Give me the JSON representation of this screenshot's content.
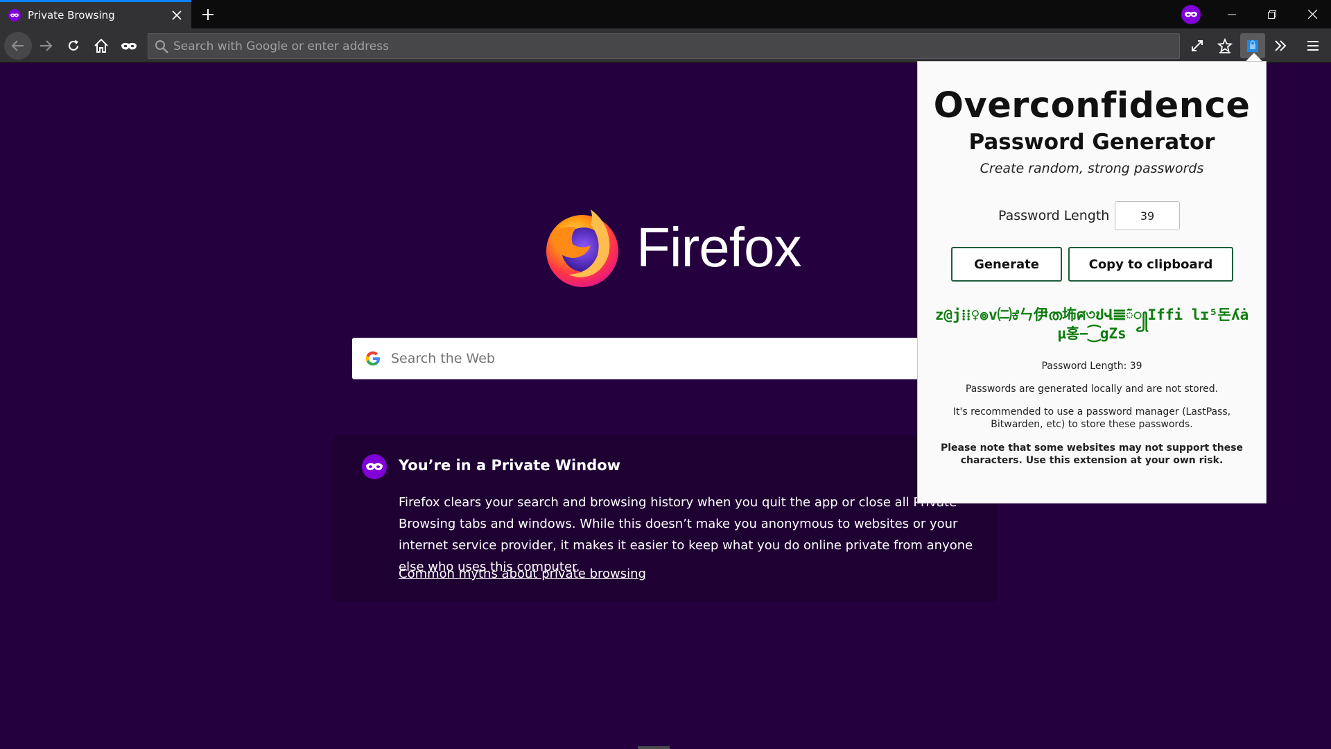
{
  "browser": {
    "tab": {
      "title": "Private Browsing"
    },
    "urlbar": {
      "placeholder": "Search with Google or enter address"
    }
  },
  "page": {
    "logo_text": "Firefox",
    "search_placeholder": "Search the Web",
    "info": {
      "title": "You’re in a Private Window",
      "body": "Firefox clears your search and browsing history when you quit the app or close all Private Browsing tabs and windows. While this doesn’t make you anonymous to websites or your internet service provider, it makes it easier to keep what you do online private from anyone else who uses this computer.",
      "link": "Common myths about private browsing"
    }
  },
  "popup": {
    "title": "Overconfidence",
    "subtitle": "Password Generator",
    "description": "Create random, strong passwords",
    "length_label": "Password Length",
    "length_value": "39",
    "generate_label": "Generate",
    "copy_label": "Copy to clipboard",
    "password": "z@j⁞⁞♀๏v㈡ಕೆㄣ伊ത㘵ศ৩ປՎ𝌆ᰶ꧀Iffi lɪ⁵돈ʎȧµ홍−⁐gZs",
    "length_info": "Password Length: 39",
    "note_local": "Passwords are generated locally and are not stored.",
    "note_manager": "It's recommended to use a password manager (LastPass, Bitwarden, etc) to store these passwords.",
    "note_warning": "Please note that some websites may not support these characters. Use this extension at your own risk."
  },
  "colors": {
    "page_bg": "#25003e",
    "card_bg": "#1f0033",
    "toolbar": "#323234",
    "tabstrip": "#0c0c0d",
    "accent": "#0a84ff",
    "password_green": "#0d7c0d",
    "button_border": "#1c5c3c",
    "private_purple": "#8000d7"
  }
}
